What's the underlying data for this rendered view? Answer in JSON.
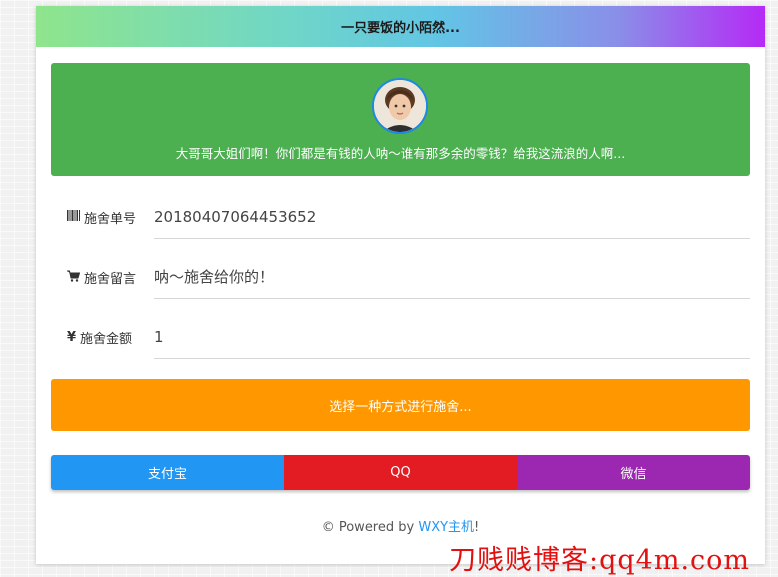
{
  "header": {
    "title": "一只要饭的小陌然..."
  },
  "banner": {
    "avatar_icon": "child-avatar",
    "message": "大哥哥大姐们啊！你们都是有钱的人呐～谁有那多余的零钱？给我这流浪的人啊..."
  },
  "fields": [
    {
      "icon": "barcode-icon",
      "label": "施舍单号",
      "value": "20180407064453652"
    },
    {
      "icon": "cart-icon",
      "label": "施舍留言",
      "value": "呐～施舍给你的！"
    },
    {
      "icon": "yen-icon",
      "label": "施舍金额",
      "value": "1"
    }
  ],
  "choose_button": "选择一种方式进行施舍...",
  "payment": {
    "alipay": "支付宝",
    "qq": "QQ",
    "wechat": "微信"
  },
  "colors": {
    "banner": "#4caf50",
    "choose": "#ff9800",
    "alipay": "#2196f3",
    "qq": "#e31c24",
    "wechat": "#9c27b0"
  },
  "footer": {
    "prefix": "© Powered by ",
    "link": "WXY主机",
    "suffix": "!"
  },
  "watermark": "刀贱贱博客:qq4m.com"
}
